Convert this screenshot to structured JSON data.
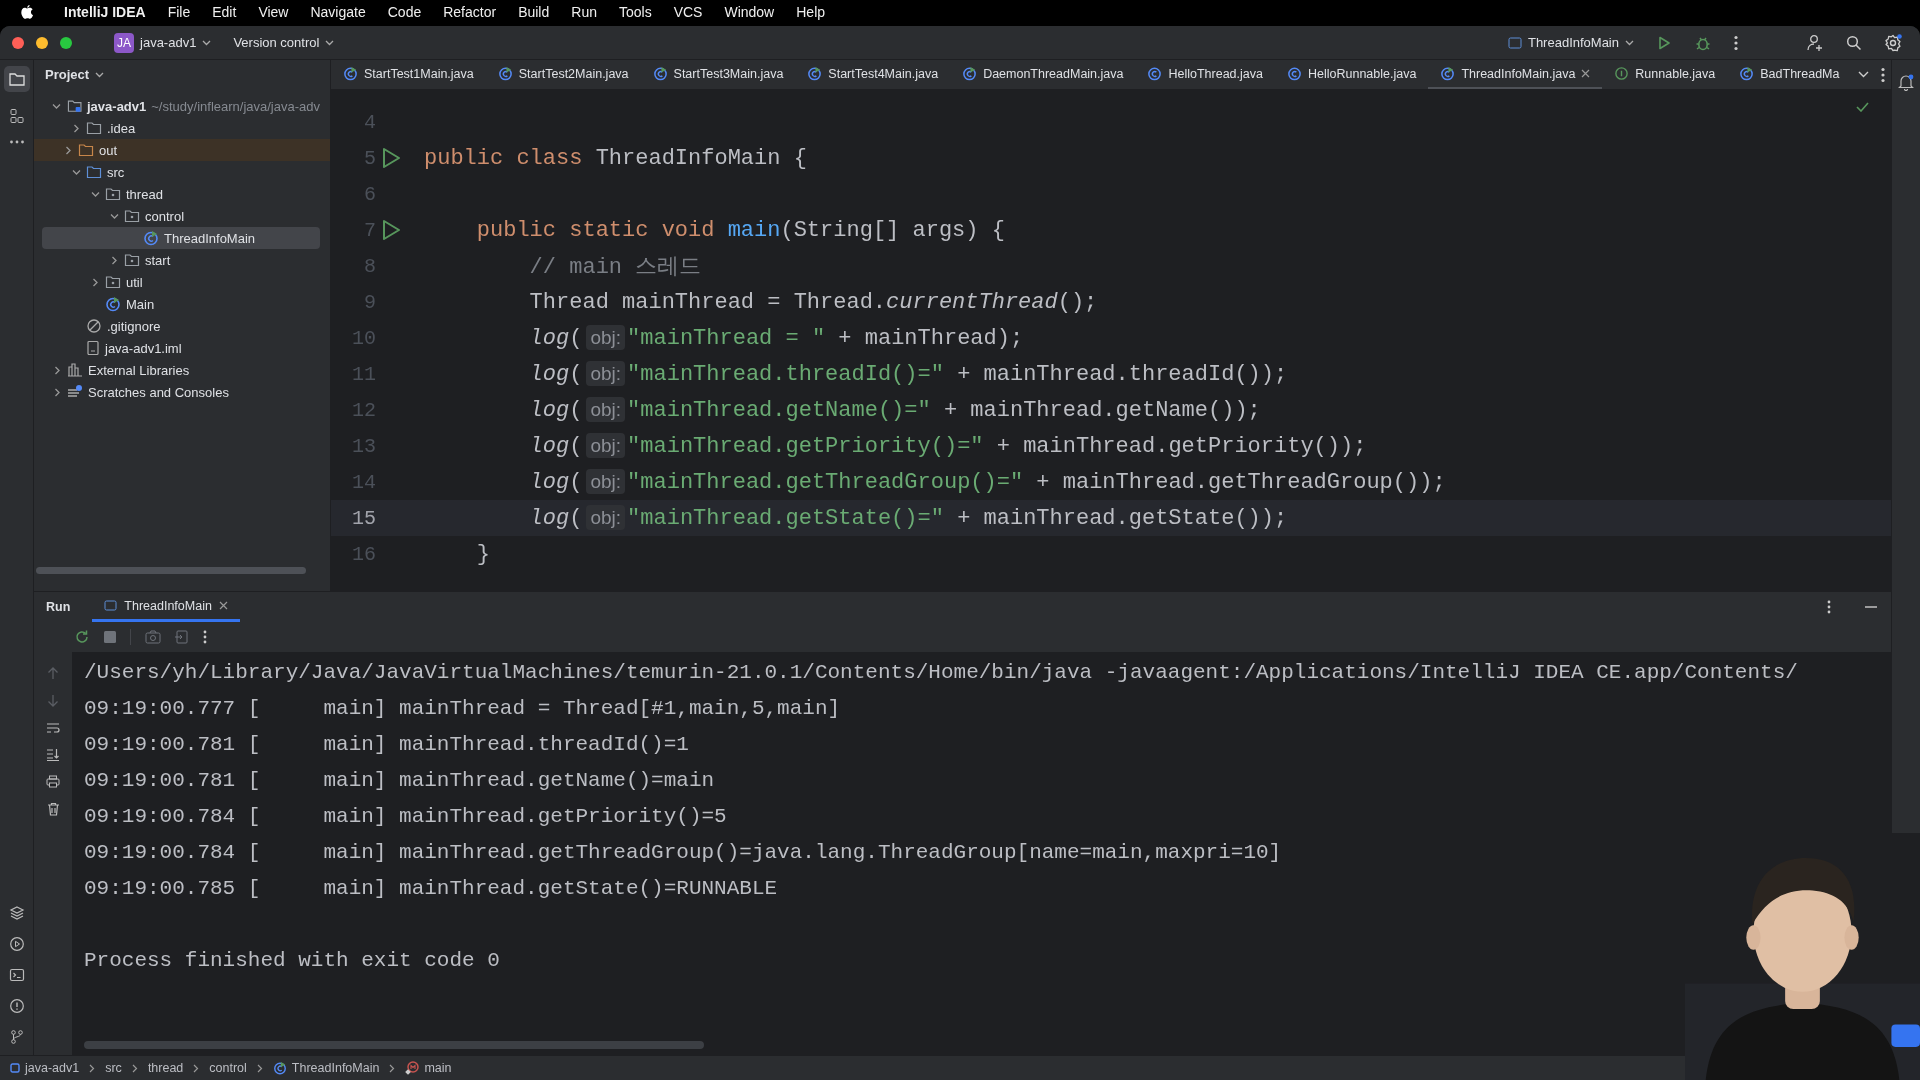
{
  "menu_bar": {
    "app": "IntelliJ IDEA",
    "items": [
      "File",
      "Edit",
      "View",
      "Navigate",
      "Code",
      "Refactor",
      "Build",
      "Run",
      "Tools",
      "VCS",
      "Window",
      "Help"
    ]
  },
  "toolbar": {
    "project_badge": "JA",
    "project": "java-adv1",
    "vcs": "Version control",
    "run_config": "ThreadInfoMain"
  },
  "project_panel": {
    "title": "Project",
    "tree": [
      {
        "name": "java-adv1",
        "path": "~/study/inflearn/java/java-adv",
        "kind": "module",
        "expanded": true,
        "selected": false,
        "children": [
          {
            "name": ".idea",
            "kind": "folder",
            "expanded": false,
            "selected": false
          },
          {
            "name": "out",
            "kind": "excluded",
            "expanded": false,
            "selected": false
          },
          {
            "name": "src",
            "kind": "source",
            "expanded": true,
            "selected": false,
            "children": [
              {
                "name": "thread",
                "kind": "package",
                "expanded": true,
                "selected": false,
                "children": [
                  {
                    "name": "control",
                    "kind": "package",
                    "expanded": true,
                    "selected": false,
                    "children": [
                      {
                        "name": "ThreadInfoMain",
                        "kind": "main-class",
                        "selected": true
                      }
                    ]
                  },
                  {
                    "name": "start",
                    "kind": "package",
                    "expanded": false,
                    "selected": false
                  }
                ]
              },
              {
                "name": "util",
                "kind": "package",
                "expanded": false,
                "selected": false
              },
              {
                "name": "Main",
                "kind": "main-class",
                "selected": false
              }
            ]
          },
          {
            "name": ".gitignore",
            "kind": "ignore",
            "selected": false
          },
          {
            "name": "java-adv1.iml",
            "kind": "file",
            "selected": false
          }
        ]
      },
      {
        "name": "External Libraries",
        "kind": "libraries",
        "expanded": false,
        "selected": false
      },
      {
        "name": "Scratches and Consoles",
        "kind": "scratches",
        "expanded": false,
        "selected": false
      }
    ]
  },
  "editor": {
    "tabs": [
      {
        "label": "StartTest1Main.java",
        "kind": "main-class",
        "selected": false
      },
      {
        "label": "StartTest2Main.java",
        "kind": "main-class",
        "selected": false
      },
      {
        "label": "StartTest3Main.java",
        "kind": "main-class",
        "selected": false
      },
      {
        "label": "StartTest4Main.java",
        "kind": "main-class",
        "selected": false
      },
      {
        "label": "DaemonThreadMain.java",
        "kind": "main-class",
        "selected": false
      },
      {
        "label": "HelloThread.java",
        "kind": "class",
        "selected": false
      },
      {
        "label": "HelloRunnable.java",
        "kind": "class",
        "selected": false
      },
      {
        "label": "ThreadInfoMain.java",
        "kind": "main-class",
        "selected": true
      },
      {
        "label": "Runnable.java",
        "kind": "interface",
        "selected": false
      },
      {
        "label": "BadThreadMa",
        "kind": "main-class",
        "selected": false
      }
    ],
    "lines": [
      {
        "number": "4",
        "run": false,
        "current": false
      },
      {
        "number": "5",
        "run": true,
        "current": false,
        "tokens": [
          {
            "kind": "kw",
            "text": "public class "
          },
          {
            "kind": "plain",
            "text": "ThreadInfoMain {"
          }
        ]
      },
      {
        "number": "6",
        "run": false,
        "current": false
      },
      {
        "number": "7",
        "run": true,
        "current": false,
        "tokens": [
          {
            "kind": "kw",
            "text": "    public static void "
          },
          {
            "kind": "decl",
            "text": "main"
          },
          {
            "kind": "plain",
            "text": "(String[] args) {"
          }
        ]
      },
      {
        "number": "8",
        "run": false,
        "current": false,
        "tokens": [
          {
            "kind": "comment",
            "text": "        // main 스레드"
          }
        ]
      },
      {
        "number": "9",
        "run": false,
        "current": false,
        "tokens": [
          {
            "kind": "plain",
            "text": "        Thread mainThread = Thread."
          },
          {
            "kind": "italic",
            "text": "currentThread"
          },
          {
            "kind": "plain",
            "text": "();"
          }
        ]
      },
      {
        "number": "10",
        "run": false,
        "current": false,
        "tokens": [
          {
            "kind": "italic",
            "text": "        log"
          },
          {
            "kind": "plain",
            "text": "("
          },
          {
            "kind": "hint",
            "text": "obj:"
          },
          {
            "kind": "str",
            "text": "\"mainThread = \""
          },
          {
            "kind": "plain",
            "text": " + mainThread);"
          }
        ]
      },
      {
        "number": "11",
        "run": false,
        "current": false,
        "tokens": [
          {
            "kind": "italic",
            "text": "        log"
          },
          {
            "kind": "plain",
            "text": "("
          },
          {
            "kind": "hint",
            "text": "obj:"
          },
          {
            "kind": "str",
            "text": "\"mainThread.threadId()=\""
          },
          {
            "kind": "plain",
            "text": " + mainThread.threadId());"
          }
        ]
      },
      {
        "number": "12",
        "run": false,
        "current": false,
        "tokens": [
          {
            "kind": "italic",
            "text": "        log"
          },
          {
            "kind": "plain",
            "text": "("
          },
          {
            "kind": "hint",
            "text": "obj:"
          },
          {
            "kind": "str",
            "text": "\"mainThread.getName()=\""
          },
          {
            "kind": "plain",
            "text": " + mainThread.getName());"
          }
        ]
      },
      {
        "number": "13",
        "run": false,
        "current": false,
        "tokens": [
          {
            "kind": "italic",
            "text": "        log"
          },
          {
            "kind": "plain",
            "text": "("
          },
          {
            "kind": "hint",
            "text": "obj:"
          },
          {
            "kind": "str",
            "text": "\"mainThread.getPriority()=\""
          },
          {
            "kind": "plain",
            "text": " + mainThread.getPriority());"
          }
        ]
      },
      {
        "number": "14",
        "run": false,
        "current": false,
        "tokens": [
          {
            "kind": "italic",
            "text": "        log"
          },
          {
            "kind": "plain",
            "text": "("
          },
          {
            "kind": "hint",
            "text": "obj:"
          },
          {
            "kind": "str",
            "text": "\"mainThread.getThreadGroup()=\""
          },
          {
            "kind": "plain",
            "text": " + mainThread.getThreadGroup());"
          }
        ]
      },
      {
        "number": "15",
        "run": false,
        "current": true,
        "tokens": [
          {
            "kind": "italic",
            "text": "        log"
          },
          {
            "kind": "plain",
            "text": "("
          },
          {
            "kind": "hint",
            "text": "obj:"
          },
          {
            "kind": "str",
            "text": "\"mainThread.getState()=\""
          },
          {
            "kind": "plain",
            "text": " + mainThread.getState());"
          }
        ]
      },
      {
        "number": "16",
        "run": false,
        "current": false,
        "tokens": [
          {
            "kind": "plain",
            "text": "    }"
          }
        ]
      }
    ]
  },
  "run_panel": {
    "title": "Run",
    "tabs": [
      {
        "label": "ThreadInfoMain",
        "selected": true
      }
    ],
    "output": [
      {
        "kind": "command",
        "text": "/Users/yh/Library/Java/JavaVirtualMachines/temurin-21.0.1/Contents/Home/bin/java -javaagent:/Applications/IntelliJ IDEA CE.app/Contents/"
      },
      {
        "kind": "log",
        "text": "09:19:00.777 [     main] mainThread = Thread[#1,main,5,main]"
      },
      {
        "kind": "log",
        "text": "09:19:00.781 [     main] mainThread.threadId()=1"
      },
      {
        "kind": "log",
        "text": "09:19:00.781 [     main] mainThread.getName()=main"
      },
      {
        "kind": "log",
        "text": "09:19:00.784 [     main] mainThread.getPriority()=5"
      },
      {
        "kind": "log",
        "text": "09:19:00.784 [     main] mainThread.getThreadGroup()=java.lang.ThreadGroup[name=main,maxpri=10]"
      },
      {
        "kind": "log",
        "text": "09:19:00.785 [     main] mainThread.getState()=RUNNABLE"
      },
      {
        "kind": "exit",
        "text": "Process finished with exit code 0"
      }
    ]
  },
  "breadcrumbs": [
    {
      "label": "java-adv1",
      "kind": "module"
    },
    {
      "label": "src",
      "kind": "folder"
    },
    {
      "label": "thread",
      "kind": "folder"
    },
    {
      "label": "control",
      "kind": "folder"
    },
    {
      "label": "ThreadInfoMain",
      "kind": "class"
    },
    {
      "label": "main",
      "kind": "method"
    }
  ]
}
